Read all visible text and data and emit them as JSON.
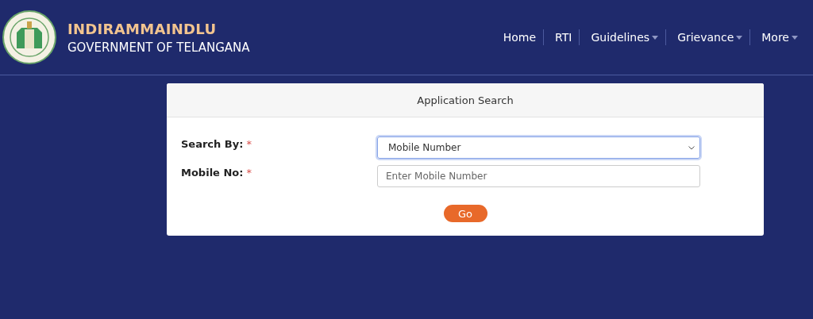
{
  "header": {
    "title": "INDIRAMMAINDLU",
    "subtitle": "GOVERNMENT OF TELANGANA"
  },
  "nav": [
    {
      "label": "Home",
      "kind": "link"
    },
    {
      "label": "RTI",
      "kind": "link"
    },
    {
      "label": "Guidelines",
      "kind": "dropdown"
    },
    {
      "label": "Grievance",
      "kind": "dropdown"
    },
    {
      "label": "More",
      "kind": "dropdown"
    }
  ],
  "card": {
    "title": "Application Search",
    "fields": [
      {
        "label": "Search By:",
        "required_mark": "*",
        "kind": "select",
        "value": "Mobile Number",
        "focused": true
      },
      {
        "label": "Mobile No:",
        "required_mark": "*",
        "kind": "input",
        "placeholder": "Enter Mobile Number",
        "focused": false
      }
    ],
    "button": "Go"
  }
}
